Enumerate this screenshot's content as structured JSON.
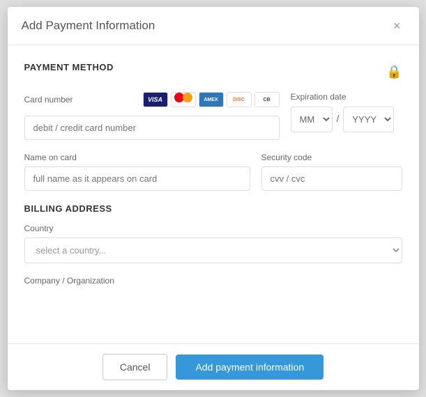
{
  "modal": {
    "title": "Add Payment Information",
    "close_label": "×"
  },
  "payment_method": {
    "section_title": "PAYMENT METHOD",
    "card_number": {
      "label": "Card number",
      "placeholder": "debit / credit card number"
    },
    "expiration": {
      "label": "Expiration date",
      "month_placeholder": "MM",
      "year_placeholder": "YYYY",
      "separator": "/"
    },
    "name_on_card": {
      "label": "Name on card",
      "placeholder": "full name as it appears on card"
    },
    "security_code": {
      "label": "Security code",
      "placeholder": "cvv / cvc"
    }
  },
  "billing_address": {
    "section_title": "BILLING ADDRESS",
    "country": {
      "label": "Country",
      "placeholder": "select a country..."
    },
    "company": {
      "label": "Company / Organization"
    }
  },
  "footer": {
    "cancel_label": "Cancel",
    "submit_label": "Add payment information"
  }
}
